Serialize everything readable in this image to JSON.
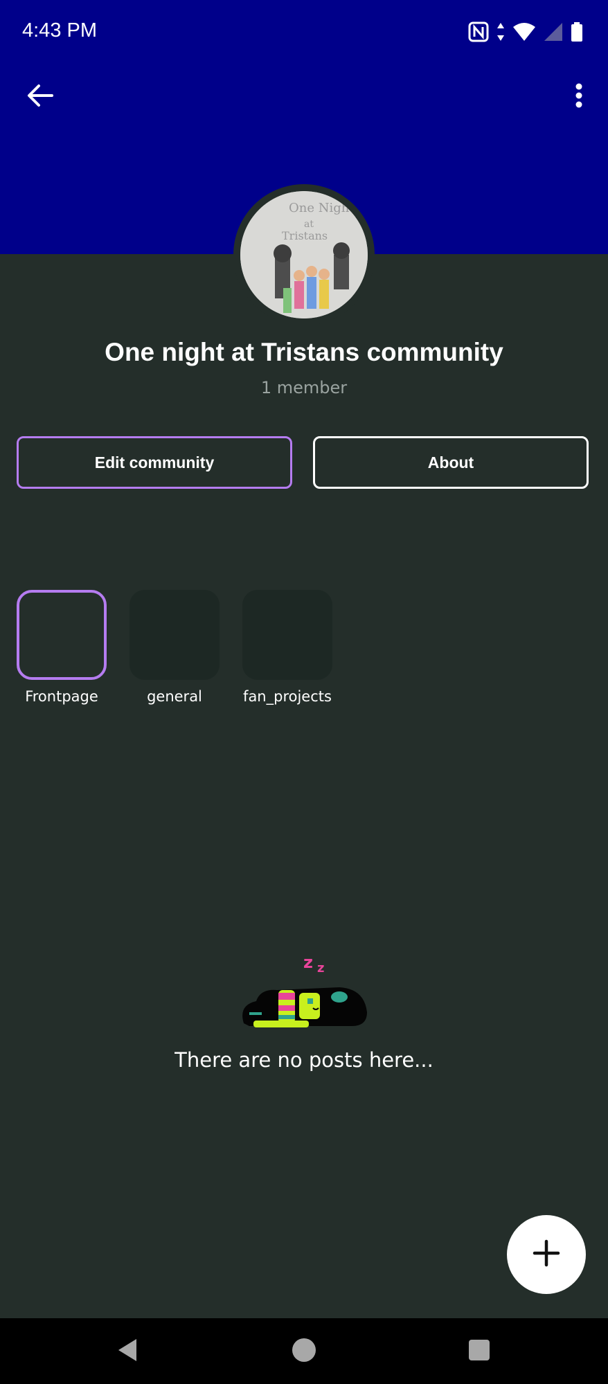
{
  "status_bar": {
    "time": "4:43 PM",
    "icons": [
      "nfc-icon",
      "data-arrows-icon",
      "wifi-icon",
      "cell-signal-icon",
      "battery-icon"
    ]
  },
  "toolbar": {
    "back_icon": "arrow-left-icon",
    "more_icon": "more-vertical-icon"
  },
  "community": {
    "name": "One night at Tristans community",
    "member_count": "1 member",
    "header_color": "#00008a",
    "background_color": "#242e2a",
    "accent_color": "#b57cf0"
  },
  "actions": {
    "edit_label": "Edit community",
    "about_label": "About"
  },
  "channels": [
    {
      "label": "Frontpage",
      "selected": true
    },
    {
      "label": "general",
      "selected": false
    },
    {
      "label": "fan_projects",
      "selected": false
    }
  ],
  "empty_state": {
    "illustration_letters": "z z",
    "message": "There are no posts here..."
  },
  "fab": {
    "icon": "plus-icon"
  },
  "nav_bar": {
    "icons": [
      "nav-back-icon",
      "nav-home-icon",
      "nav-recents-icon"
    ]
  }
}
